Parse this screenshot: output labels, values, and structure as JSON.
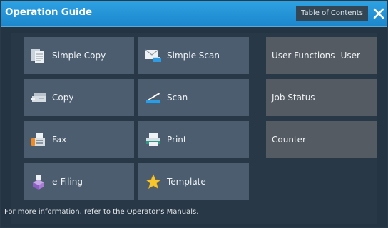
{
  "header": {
    "title": "Operation Guide",
    "toc_label": "Table of Contents"
  },
  "tiles": {
    "simple_copy": "Simple Copy",
    "simple_scan": "Simple Scan",
    "copy": "Copy",
    "scan": "Scan",
    "fax": "Fax",
    "print": "Print",
    "efiling": "e-Filing",
    "template": "Template"
  },
  "side": {
    "user_functions": "User Functions -User-",
    "job_status": "Job Status",
    "counter": "Counter"
  },
  "footer": {
    "info": "For more information, refer to the Operator's Manuals."
  },
  "colors": {
    "title_bar": "#1c86cc",
    "tile": "#4b5d6e",
    "side_tile": "#555b62",
    "background": "#253443"
  }
}
